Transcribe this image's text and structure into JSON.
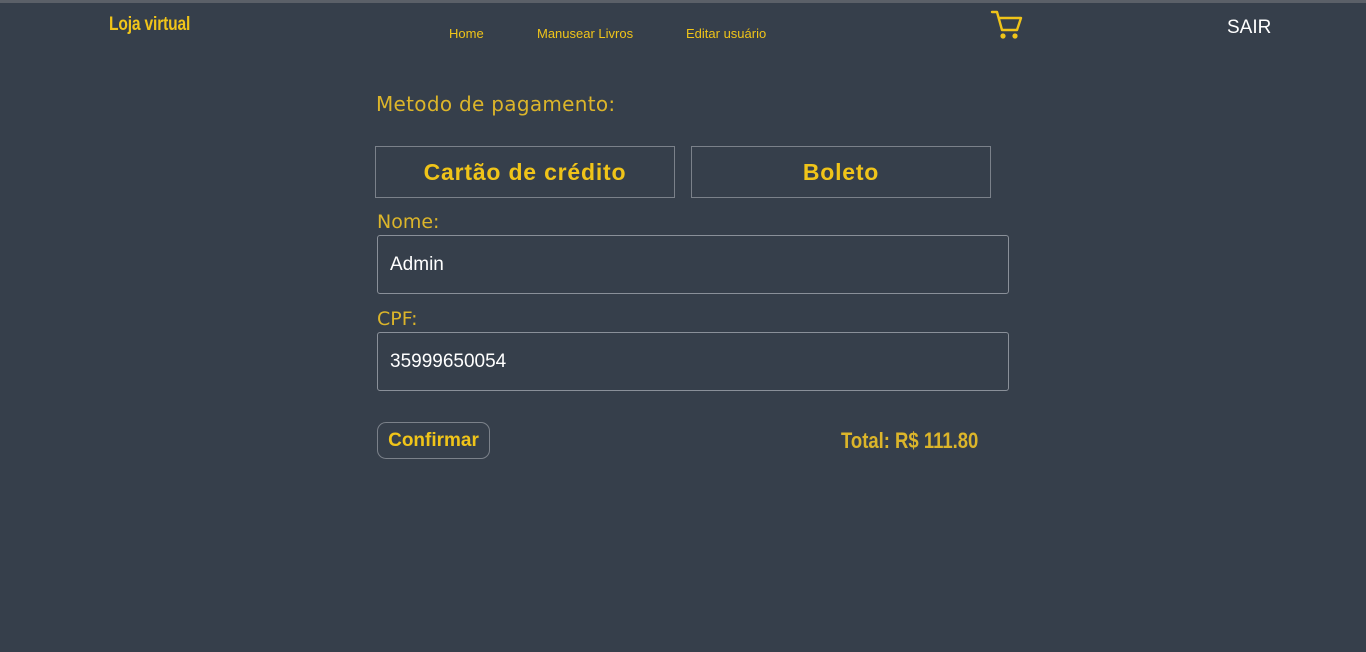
{
  "header": {
    "brand": "Loja virtual",
    "nav": {
      "home": "Home",
      "manage_books": "Manusear Livros",
      "edit_user": "Editar usuário"
    },
    "cart_icon": "shopping-cart-icon",
    "logout": "SAIR"
  },
  "payment": {
    "title": "Metodo de pagamento:",
    "methods": {
      "credit_card": "Cartão de crédito",
      "boleto": "Boleto"
    }
  },
  "form": {
    "name_label": "Nome:",
    "name_value": "Admin",
    "cpf_label": "CPF:",
    "cpf_value": "35999650054"
  },
  "footer": {
    "confirm_label": "Confirmar",
    "total": "Total: R$ 111.80"
  },
  "colors": {
    "background": "#363f4b",
    "accent": "#f0c419",
    "text": "#ffffff"
  }
}
